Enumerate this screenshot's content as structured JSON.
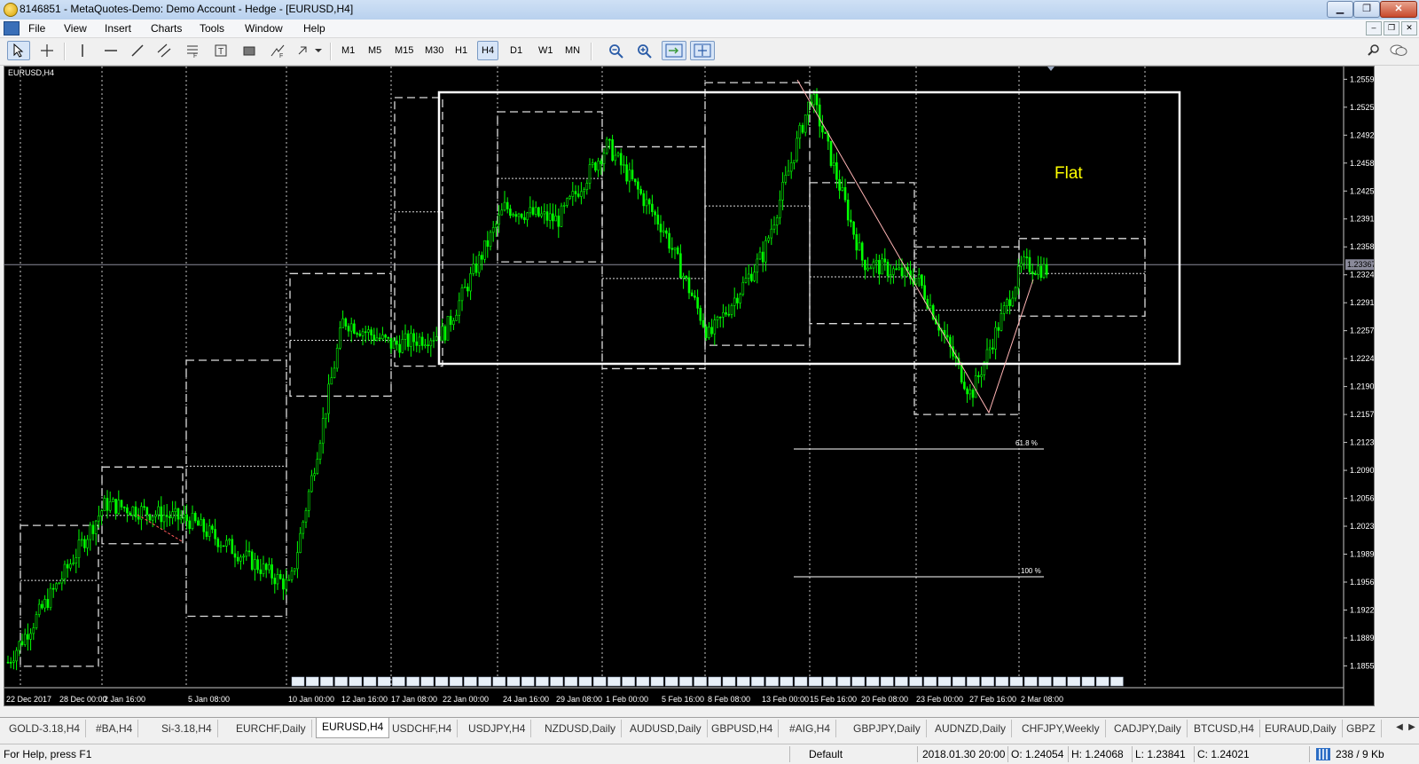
{
  "window": {
    "title": "8146851 - MetaQuotes-Demo: Demo Account - Hedge - [EURUSD,H4]",
    "minimize": "▁",
    "restore": "❐",
    "close": "✕"
  },
  "menu": {
    "items": [
      "File",
      "View",
      "Insert",
      "Charts",
      "Tools",
      "Window",
      "Help"
    ],
    "mdi": {
      "minimize": "–",
      "restore": "❐",
      "close": "✕"
    }
  },
  "toolbar": {
    "timeframes": [
      "M1",
      "M5",
      "M15",
      "M30",
      "H1",
      "H4",
      "D1",
      "W1",
      "MN"
    ],
    "active_timeframe": "H4",
    "tools": [
      "cursor-icon",
      "crosshair-icon",
      "vertical-line-icon",
      "horizontal-line-icon",
      "trendline-icon",
      "equidistant-channel-icon",
      "fibonacci-icon",
      "text-icon",
      "text-label-icon",
      "rectangle-icon",
      "arrows-icon",
      "zoom-out-icon",
      "zoom-in-icon",
      "chart-shift-icon",
      "autoscroll-icon",
      "search-icon",
      "chat-icon"
    ]
  },
  "chart": {
    "label": "EURUSD,H4",
    "annotation": "Flat",
    "fib_618": "61.8 %",
    "fib_100": "100 %",
    "current_price": "1.23367",
    "price_ticks": [
      "1.25590",
      "1.25255",
      "1.24920",
      "1.24585",
      "1.24250",
      "1.23915",
      "1.23580",
      "1.23245",
      "1.22910",
      "1.22575",
      "1.22240",
      "1.21905",
      "1.21570",
      "1.21235",
      "1.20900",
      "1.20565",
      "1.20230",
      "1.19895",
      "1.19560",
      "1.19225",
      "1.18890",
      "1.18555"
    ],
    "time_ticks": [
      "22 Dec 2017",
      "28 Dec 00:00",
      "2 Jan 16:00",
      "5 Jan 08:00",
      "10 Jan 00:00",
      "12 Jan 16:00",
      "17 Jan 08:00",
      "22 Jan 00:00",
      "24 Jan 16:00",
      "29 Jan 08:00",
      "1 Feb 00:00",
      "5 Feb 16:00",
      "8 Feb 08:00",
      "13 Feb 00:00",
      "15 Feb 16:00",
      "20 Feb 08:00",
      "23 Feb 00:00",
      "27 Feb 16:00",
      "2 Mar 08:00"
    ],
    "colors": {
      "background": "#000000",
      "candles": "#00ff00",
      "grid": "#c8c8c8",
      "text": "#ffffff",
      "annotation": "#ffff00",
      "zigzag": "#ffb4b4"
    }
  },
  "chart_data": {
    "type": "candlestick",
    "symbol": "EURUSD",
    "timeframe": "H4",
    "ylim": [
      1.184,
      1.257
    ],
    "grid": true,
    "closes_by_date": [
      {
        "x": "22 Dec 2017",
        "close": 1.186
      },
      {
        "x": "28 Dec 00:00",
        "close": 1.196
      },
      {
        "x": "2 Jan 16:00",
        "close": 1.205
      },
      {
        "x": "5 Jan 08:00",
        "close": 1.203
      },
      {
        "x": "10 Jan 00:00",
        "close": 1.195
      },
      {
        "x": "12 Jan 16:00",
        "close": 1.227
      },
      {
        "x": "17 Jan 08:00",
        "close": 1.224
      },
      {
        "x": "22 Jan 00:00",
        "close": 1.2255
      },
      {
        "x": "24 Jan 16:00",
        "close": 1.2405
      },
      {
        "x": "29 Jan 08:00",
        "close": 1.239
      },
      {
        "x": "1 Feb 00:00",
        "close": 1.248
      },
      {
        "x": "5 Feb 16:00",
        "close": 1.238
      },
      {
        "x": "8 Feb 08:00",
        "close": 1.225
      },
      {
        "x": "13 Feb 00:00",
        "close": 1.235
      },
      {
        "x": "15 Feb 16:00",
        "close": 1.254
      },
      {
        "x": "20 Feb 08:00",
        "close": 1.234
      },
      {
        "x": "23 Feb 00:00",
        "close": 1.232
      },
      {
        "x": "27 Feb 16:00",
        "close": 1.218
      },
      {
        "x": "2 Mar 08:00",
        "close": 1.2337
      }
    ]
  },
  "tabs": [
    "GOLD-3.18,H4",
    "#BA,H4",
    "Si-3.18,H4",
    "EURCHF,Daily",
    "EURUSD,H4",
    "USDCHF,H4",
    "USDJPY,H4",
    "NZDUSD,Daily",
    "AUDUSD,Daily",
    "GBPUSD,H4",
    "#AIG,H4",
    "GBPJPY,Daily",
    "AUDNZD,Daily",
    "CHFJPY,Weekly",
    "CADJPY,Daily",
    "BTCUSD,H4",
    "EURAUD,Daily",
    "GBPZ"
  ],
  "active_tab": "EURUSD,H4",
  "status": {
    "help": "For Help, press F1",
    "profile": "Default",
    "datetime": "2018.01.30 20:00",
    "open": "O: 1.24054",
    "high": "H: 1.24068",
    "low": "L: 1.23841",
    "close": "C: 1.24021",
    "traffic": "238 / 9 Kb"
  }
}
